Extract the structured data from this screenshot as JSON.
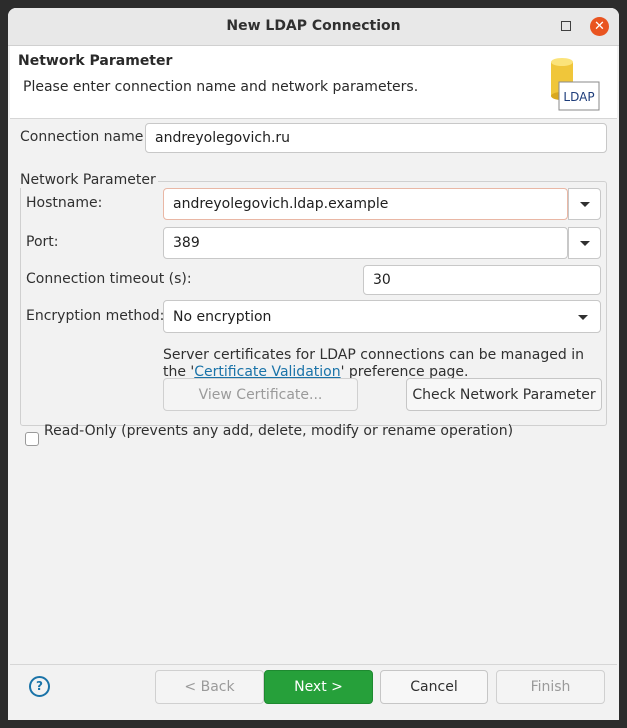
{
  "window": {
    "title": "New LDAP Connection"
  },
  "header": {
    "title": "Network Parameter",
    "description": "Please enter connection name and network parameters.",
    "icon_label": "LDAP",
    "icon_name": "ldap-database-icon"
  },
  "connection": {
    "label": "Connection name:",
    "value": "andreyolegovich.ru"
  },
  "network_group": {
    "title": "Network Parameter",
    "hostname": {
      "label": "Hostname:",
      "value": "andreyolegovich.ldap.example"
    },
    "port": {
      "label": "Port:",
      "value": "389"
    },
    "timeout": {
      "label": "Connection timeout (s):",
      "value": "30"
    },
    "encryption": {
      "label": "Encryption method:",
      "value": "No encryption"
    },
    "note": {
      "prefix": "Server certificates for LDAP connections can be managed in the '",
      "link": "Certificate Validation",
      "suffix": "' preference page."
    },
    "view_certificate": "View Certificate...",
    "check_network": "Check Network Parameter"
  },
  "readonly": {
    "label": "Read-Only (prevents any add, delete, modify or rename operation)",
    "checked": false
  },
  "footer": {
    "back": "< Back",
    "next": "Next >",
    "cancel": "Cancel",
    "finish": "Finish"
  },
  "colors": {
    "accent": "#e95420",
    "primary_button": "#26a03a",
    "link": "#1a73a8"
  }
}
